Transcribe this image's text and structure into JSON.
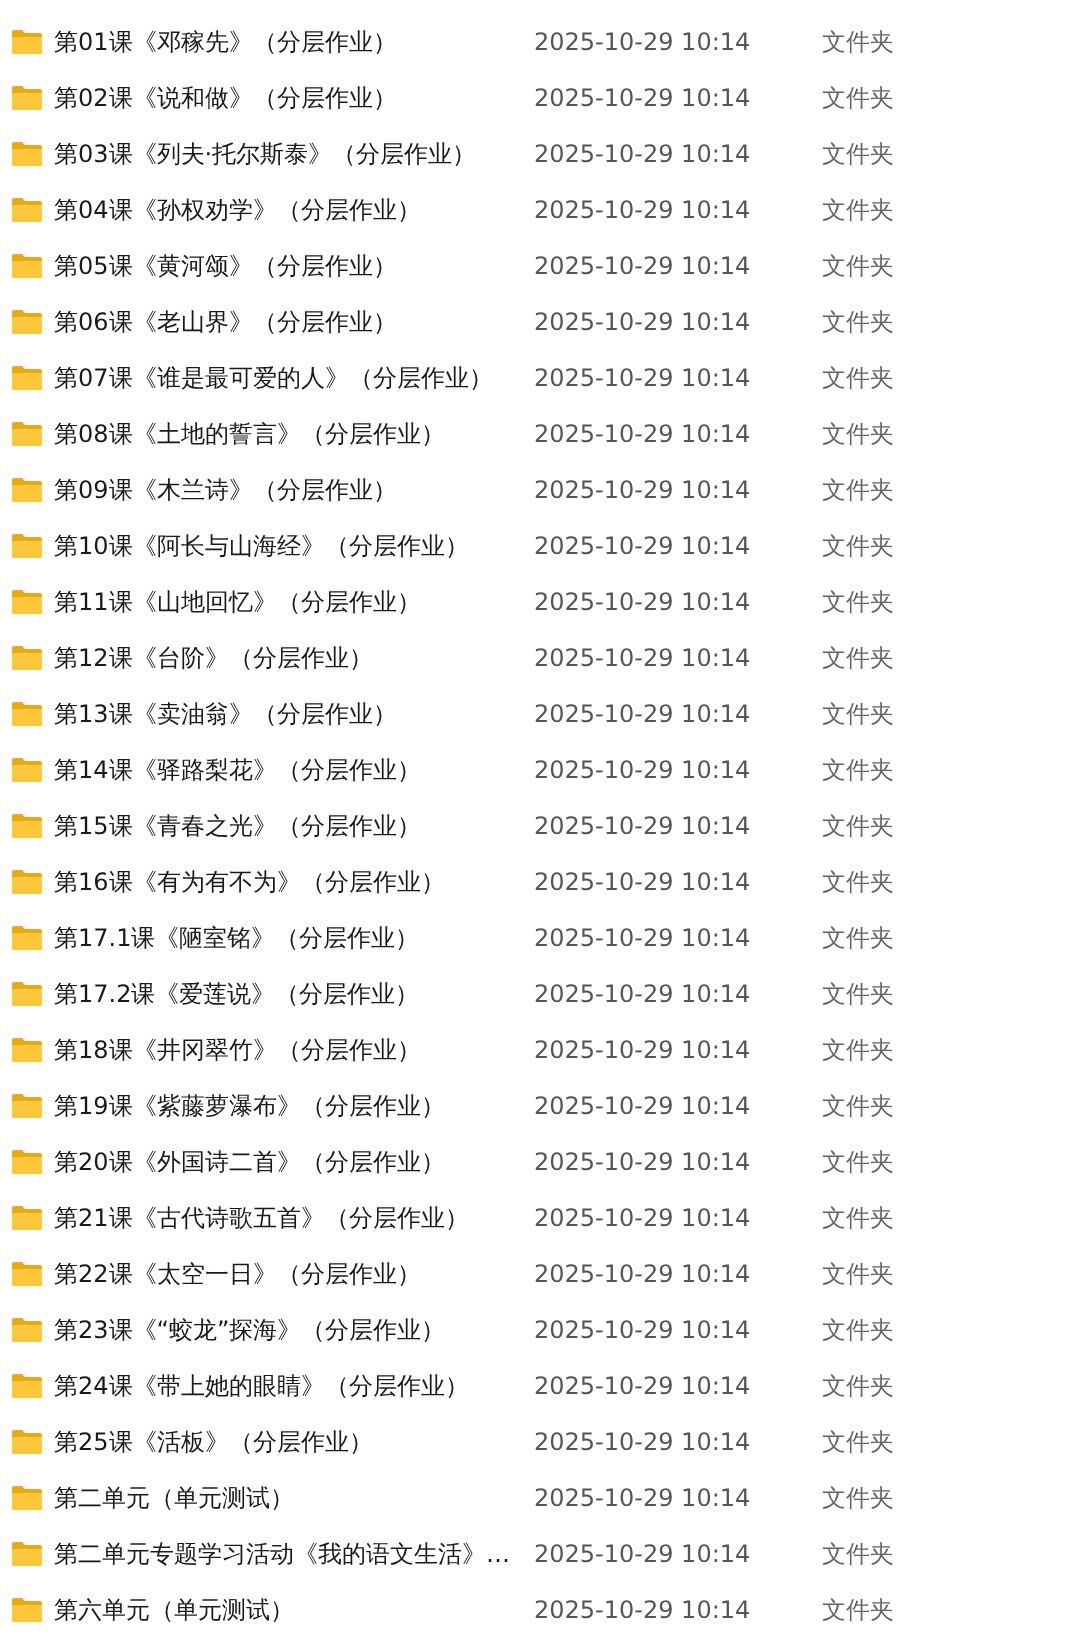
{
  "files": [
    {
      "name": "第01课《邓稼先》（分层作业）",
      "modified": "2025-10-29 10:14",
      "type": "文件夹"
    },
    {
      "name": "第02课《说和做》（分层作业）",
      "modified": "2025-10-29 10:14",
      "type": "文件夹"
    },
    {
      "name": "第03课《列夫·托尔斯泰》（分层作业）",
      "modified": "2025-10-29 10:14",
      "type": "文件夹"
    },
    {
      "name": "第04课《孙权劝学》（分层作业）",
      "modified": "2025-10-29 10:14",
      "type": "文件夹"
    },
    {
      "name": "第05课《黄河颂》（分层作业）",
      "modified": "2025-10-29 10:14",
      "type": "文件夹"
    },
    {
      "name": "第06课《老山界》（分层作业）",
      "modified": "2025-10-29 10:14",
      "type": "文件夹"
    },
    {
      "name": "第07课《谁是最可爱的人》（分层作业）",
      "modified": "2025-10-29 10:14",
      "type": "文件夹"
    },
    {
      "name": "第08课《土地的誓言》（分层作业）",
      "modified": "2025-10-29 10:14",
      "type": "文件夹"
    },
    {
      "name": "第09课《木兰诗》（分层作业）",
      "modified": "2025-10-29 10:14",
      "type": "文件夹"
    },
    {
      "name": "第10课《阿长与山海经》（分层作业）",
      "modified": "2025-10-29 10:14",
      "type": "文件夹"
    },
    {
      "name": "第11课《山地回忆》（分层作业）",
      "modified": "2025-10-29 10:14",
      "type": "文件夹"
    },
    {
      "name": "第12课《台阶》（分层作业）",
      "modified": "2025-10-29 10:14",
      "type": "文件夹"
    },
    {
      "name": "第13课《卖油翁》（分层作业）",
      "modified": "2025-10-29 10:14",
      "type": "文件夹"
    },
    {
      "name": "第14课《驿路梨花》（分层作业）",
      "modified": "2025-10-29 10:14",
      "type": "文件夹"
    },
    {
      "name": "第15课《青春之光》（分层作业）",
      "modified": "2025-10-29 10:14",
      "type": "文件夹"
    },
    {
      "name": "第16课《有为有不为》（分层作业）",
      "modified": "2025-10-29 10:14",
      "type": "文件夹"
    },
    {
      "name": "第17.1课《陋室铭》（分层作业）",
      "modified": "2025-10-29 10:14",
      "type": "文件夹"
    },
    {
      "name": "第17.2课《爱莲说》（分层作业）",
      "modified": "2025-10-29 10:14",
      "type": "文件夹"
    },
    {
      "name": "第18课《井冈翠竹》（分层作业）",
      "modified": "2025-10-29 10:14",
      "type": "文件夹"
    },
    {
      "name": "第19课《紫藤萝瀑布》（分层作业）",
      "modified": "2025-10-29 10:14",
      "type": "文件夹"
    },
    {
      "name": "第20课《外国诗二首》（分层作业）",
      "modified": "2025-10-29 10:14",
      "type": "文件夹"
    },
    {
      "name": "第21课《古代诗歌五首》（分层作业）",
      "modified": "2025-10-29 10:14",
      "type": "文件夹"
    },
    {
      "name": "第22课《太空一日》（分层作业）",
      "modified": "2025-10-29 10:14",
      "type": "文件夹"
    },
    {
      "name": "第23课《“蛟龙”探海》（分层作业）",
      "modified": "2025-10-29 10:14",
      "type": "文件夹"
    },
    {
      "name": "第24课《带上她的眼睛》（分层作业）",
      "modified": "2025-10-29 10:14",
      "type": "文件夹"
    },
    {
      "name": "第25课《活板》（分层作业）",
      "modified": "2025-10-29 10:14",
      "type": "文件夹"
    },
    {
      "name": "第二单元（单元测试）",
      "modified": "2025-10-29 10:14",
      "type": "文件夹"
    },
    {
      "name": "第二单元专题学习活动《我的语文生活》…",
      "modified": "2025-10-29 10:14",
      "type": "文件夹"
    },
    {
      "name": "第六单元（单元测试）",
      "modified": "2025-10-29 10:14",
      "type": "文件夹"
    }
  ]
}
